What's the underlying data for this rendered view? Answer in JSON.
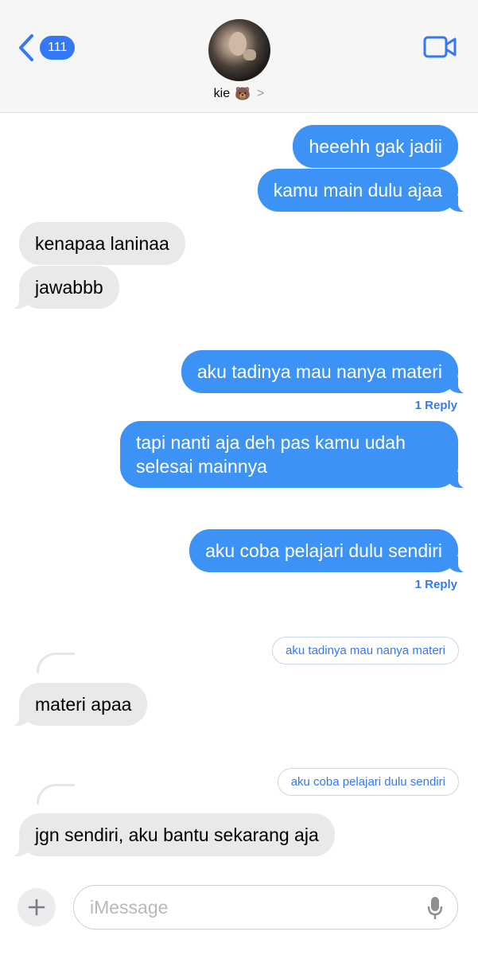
{
  "header": {
    "back_count": "111",
    "contact_name": "kie",
    "contact_emoji": "🐻",
    "chevron": ">"
  },
  "messages": [
    {
      "from": "me",
      "text": "heeehh gak jadii"
    },
    {
      "from": "me",
      "text": "kamu main dulu ajaa"
    },
    {
      "from": "them",
      "text": "kenapaa laninaa"
    },
    {
      "from": "them",
      "text": "jawabbb"
    },
    {
      "from": "me",
      "text": "aku tadinya mau nanya materi",
      "replies": "1 Reply"
    },
    {
      "from": "me",
      "text_line1": "tapi nanti aja deh pas kamu udah",
      "text_line2": "selesai mainnya"
    },
    {
      "from": "me",
      "text": "aku coba pelajari dulu sendiri",
      "replies": "1 Reply"
    },
    {
      "from": "them",
      "quote": "aku tadinya mau nanya materi",
      "text": "materi apaa"
    },
    {
      "from": "them",
      "quote": "aku coba pelajari dulu sendiri",
      "text": "jgn sendiri, aku bantu sekarang aja"
    }
  ],
  "composer": {
    "placeholder": "iMessage"
  },
  "colors": {
    "sent": "#3d93f5",
    "received": "#e9e9eb",
    "accent": "#3478f6"
  }
}
